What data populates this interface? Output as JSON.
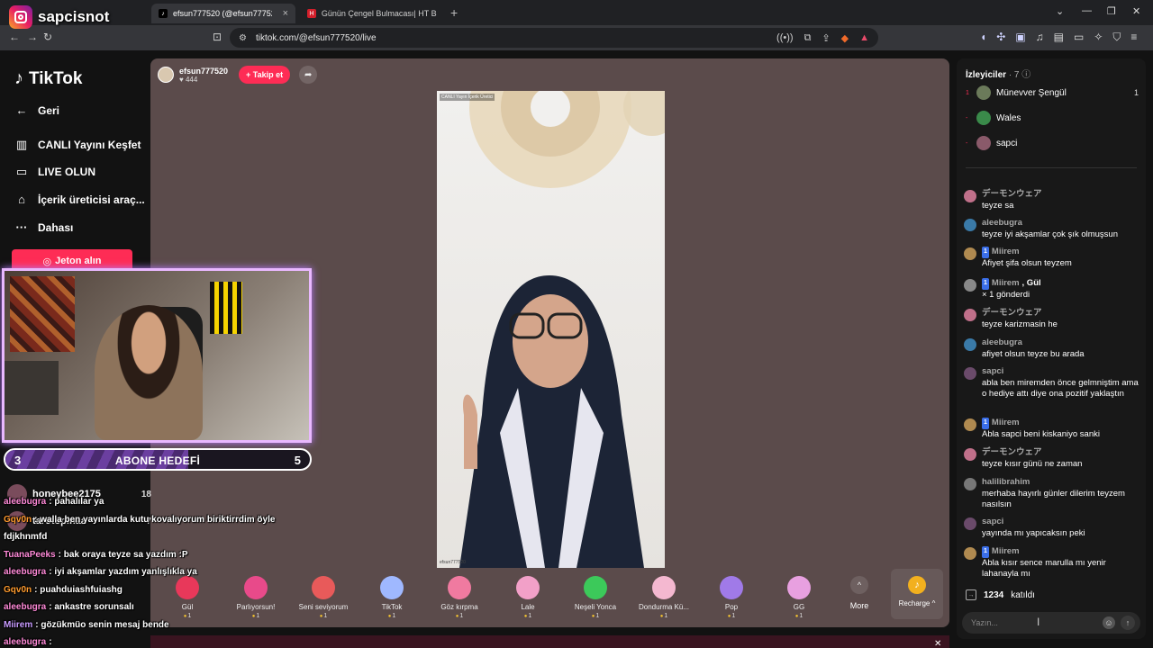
{
  "browser": {
    "tabs": [
      {
        "label": "efsun777520 (@efsun77752...",
        "active": true
      },
      {
        "label": "Günün Çengel Bulmacası| HT Bulmac...",
        "active": false
      }
    ],
    "url": "tiktok.com/@efsun777520/live",
    "newtab_glyph": "+",
    "window_controls": [
      "⌄",
      "—",
      "❐",
      "✕"
    ]
  },
  "instagram_overlay": {
    "handle": "sapcisnot"
  },
  "sidebar": {
    "brand": "TikTok",
    "back_label": "Geri",
    "items": [
      {
        "label": "CANLI Yayını Keşfet",
        "icon": "explore-live-icon"
      },
      {
        "label": "LIVE OLUN",
        "icon": "go-live-icon"
      },
      {
        "label": "İçerik üreticisi araç...",
        "icon": "creator-tools-icon"
      },
      {
        "label": "Dahası",
        "icon": "more-dots-icon"
      }
    ],
    "coin_button": "Jeton alın"
  },
  "stream": {
    "host_name": "efsun777520",
    "host_likes": "444",
    "follow_label": "+ Takip et",
    "video_tag": "CANLI Yayın İçerik Üretici",
    "video_handle": "efsun777520"
  },
  "gifts": [
    {
      "name": "Gül",
      "price": "1",
      "color": "#e8385a"
    },
    {
      "name": "Parlıyorsun!",
      "price": "1",
      "color": "#e84a8a"
    },
    {
      "name": "Seni seviyorum",
      "price": "1",
      "color": "#e85a5a"
    },
    {
      "name": "TikTok",
      "price": "1",
      "color": "#9fb8ff"
    },
    {
      "name": "Göz kırpma",
      "price": "1",
      "color": "#f07aa0"
    },
    {
      "name": "Lale",
      "price": "1",
      "color": "#f2a0c8"
    },
    {
      "name": "Neşeli Yonca",
      "price": "1",
      "color": "#3cc95a"
    },
    {
      "name": "Dondurma Kü...",
      "price": "1",
      "color": "#f4b8d0"
    },
    {
      "name": "Pop",
      "price": "1",
      "color": "#a07ae8"
    },
    {
      "name": "GG",
      "price": "1",
      "color": "#e8a0e0"
    }
  ],
  "more_label": "More",
  "recharge_label": "Recharge",
  "subgoal": {
    "current": "3",
    "title": "ABONE HEDEFİ",
    "target": "5",
    "progress": 0.6
  },
  "ranking": [
    {
      "name": "honeybee2175",
      "count": "18"
    },
    {
      "name": "tarotopinaa",
      "count": "7"
    }
  ],
  "stream_chat": [
    {
      "user": "aleebugra",
      "text": ": pahalılar ya",
      "color": "#ff8ad8"
    },
    {
      "user": "Gqv0n",
      "text": ": walla ben yayınlarda kutu kovalıyorum biriktirrdim öyle",
      "color": "#ff9b2e"
    },
    {
      "user": "fdjkhnmfd",
      "text": "",
      "color": "#ffffff"
    },
    {
      "user": "TuanaPeeks",
      "text": ": bak oraya teyze sa yazdım :P",
      "color": "#ff8ad8"
    },
    {
      "user": "aleebugra",
      "text": ": iyi akşamlar yazdım yanlışlıkla ya",
      "color": "#ff8ad8"
    },
    {
      "user": "Gqv0n",
      "text": ": puahduiashfuiashg",
      "color": "#ff9b2e"
    },
    {
      "user": "aleebugra",
      "text": ": ankastre sorunsalı",
      "color": "#ff8ad8"
    },
    {
      "user": "Miirem",
      "text": ": gözükmüo senin mesaj bende",
      "color": "#c89bff"
    },
    {
      "user": "aleebugra",
      "text": ":",
      "color": "#ff8ad8"
    }
  ],
  "viewers": {
    "title": "İzleyiciler",
    "count": "· 7",
    "list": [
      {
        "rank": "1",
        "name": "Münevver Şengül",
        "count": "1"
      },
      {
        "rank": "-",
        "name": "Wales",
        "count": ""
      },
      {
        "rank": "-",
        "name": "sapci",
        "count": ""
      }
    ]
  },
  "chat": [
    {
      "user": "デーモンウェア",
      "text": "teyze sa",
      "lvl": ""
    },
    {
      "user": "aleebugra",
      "text": "teyze iyi akşamlar çok şık olmuşsun",
      "lvl": ""
    },
    {
      "user": "Miirem",
      "text": "Afiyet şifa olsun teyzem",
      "lvl": "1"
    },
    {
      "user": "Miirem",
      "text": "× 1 gönderdi",
      "lvl": "1",
      "gift": ", Gül"
    },
    {
      "user": "デーモンウェア",
      "text": "teyze karizmasin he",
      "lvl": ""
    },
    {
      "user": "aleebugra",
      "text": "afiyet olsun teyze bu arada",
      "lvl": ""
    },
    {
      "user": "sapci",
      "text": "abla ben miremden önce gelmniştim ama o hediye attı diye ona pozitif yaklaştın",
      "lvl": ""
    },
    {
      "user": "Miirem",
      "text": "Abla sapci beni kiskaniyo sanki",
      "lvl": "1"
    },
    {
      "user": "デーモンウェア",
      "text": "teyze kısır günü ne zaman",
      "lvl": ""
    },
    {
      "user": "halilibrahim",
      "text": "merhaba hayırlı günler dilerim teyzem nasılsın",
      "lvl": ""
    },
    {
      "user": "sapci",
      "text": "yayında mı yapıcaksın peki",
      "lvl": ""
    },
    {
      "user": "Miirem",
      "text": "Abla kısır sence marulla mı yenir lahanayla mı",
      "lvl": "1"
    }
  ],
  "joined": {
    "count": "1234",
    "label": "katıldı"
  },
  "chat_input": {
    "placeholder": "Yazın..."
  },
  "colors": {
    "accent": "#fe2c55",
    "stage_bg": "#5b4b4b",
    "webcam_border": "#e9b8ff"
  }
}
